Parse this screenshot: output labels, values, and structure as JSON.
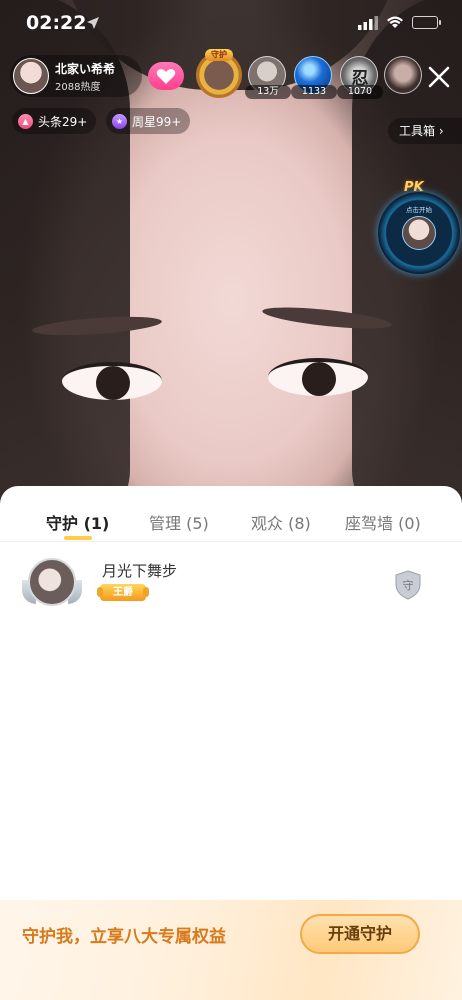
{
  "status_bar": {
    "time": "02:22"
  },
  "host": {
    "name": "北家い希希",
    "heat": "2088热度"
  },
  "guard_badge": {
    "tag": "守护"
  },
  "viewers": [
    {
      "count": "13万"
    },
    {
      "count": "1133"
    },
    {
      "count": "1070",
      "glyph": "忍"
    },
    {
      "count": ""
    }
  ],
  "tags": {
    "headline": "头条29+",
    "weekly_star": "周星99+"
  },
  "toolbox_label": "工具箱 ›",
  "pk": {
    "label": "PK",
    "sub": "点击开始"
  },
  "sheet": {
    "tabs": [
      {
        "label": "守护 (1)",
        "active": true
      },
      {
        "label": "管理 (5)",
        "active": false
      },
      {
        "label": "观众 (8)",
        "active": false
      },
      {
        "label": "座驾墙 (0)",
        "active": false
      }
    ],
    "guardians": [
      {
        "name": "月光下舞步",
        "rank": "王爵"
      }
    ]
  },
  "footer": {
    "promo_text": "守护我，立享八大专属权益",
    "button_label": "开通守护"
  },
  "colors": {
    "accent": "#ffcc4a",
    "footer_text": "#d77a1c",
    "follow": "#ff4f96"
  }
}
